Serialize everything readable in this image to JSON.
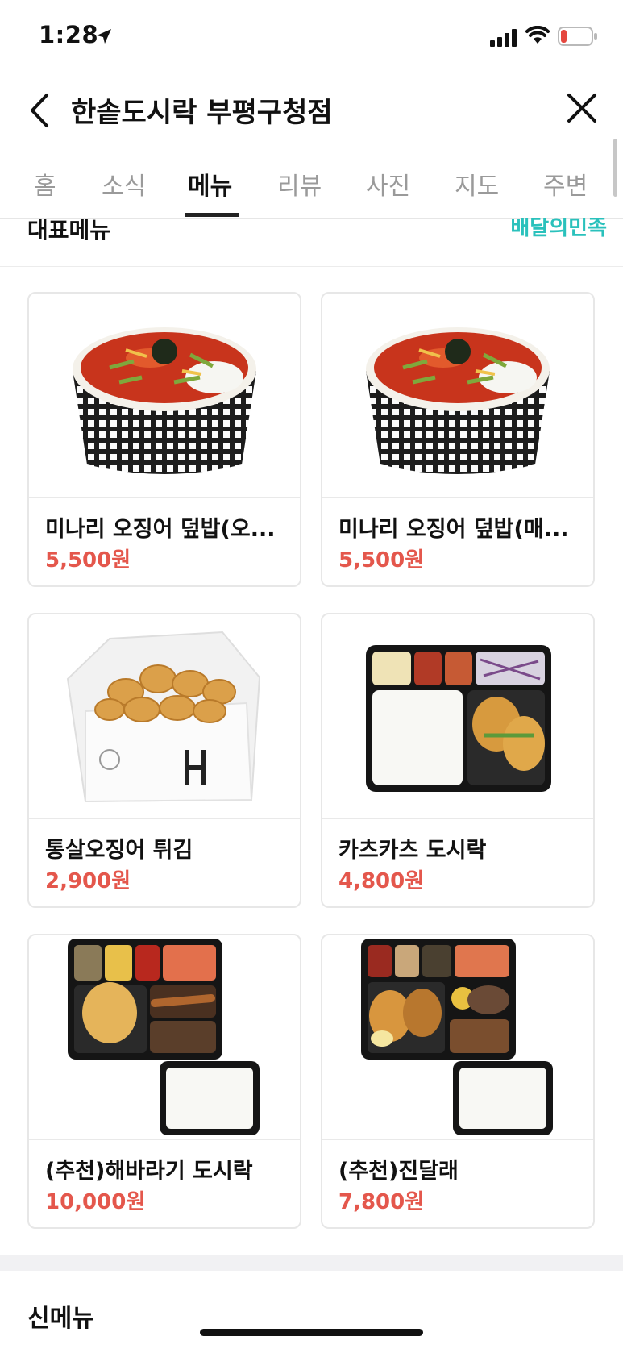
{
  "status": {
    "time": "1:28"
  },
  "header": {
    "title": "한솥도시락 부평구청점"
  },
  "tabs": [
    "홈",
    "소식",
    "메뉴",
    "리뷰",
    "사진",
    "지도",
    "주변"
  ],
  "active_tab": "메뉴",
  "section": {
    "title": "대표메뉴",
    "brand_link": "배달의민족"
  },
  "items": [
    {
      "name": "미나리 오징어 덮밥(오...",
      "price": "5,500원"
    },
    {
      "name": "미나리 오징어 덮밥(매...",
      "price": "5,500원"
    },
    {
      "name": "통살오징어 튀김",
      "price": "2,900원"
    },
    {
      "name": "카츠카츠 도시락",
      "price": "4,800원"
    },
    {
      "name": "(추천)해바라기 도시락",
      "price": "10,000원"
    },
    {
      "name": "(추천)진달래",
      "price": "7,800원"
    }
  ],
  "next_section": {
    "title": "신메뉴"
  },
  "colors": {
    "accent": "#2ac1bc",
    "price": "#e4574c",
    "battery_low": "#e5473f"
  }
}
